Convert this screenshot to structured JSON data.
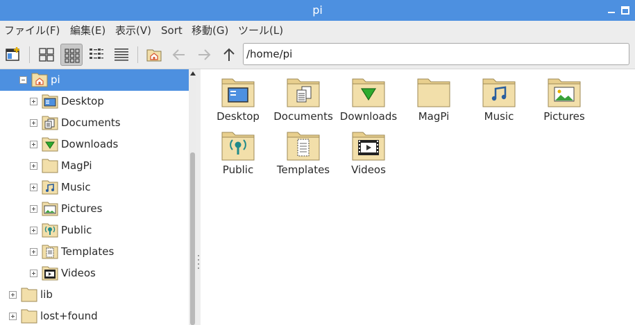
{
  "window": {
    "title": "pi"
  },
  "menu": [
    "ファイル(F)",
    "編集(E)",
    "表示(V)",
    "Sort",
    "移動(G)",
    "ツール(L)"
  ],
  "toolbar": {
    "path_value": "/home/pi",
    "active_view": "icon-view"
  },
  "sidebar": {
    "items": [
      {
        "label": "pi",
        "icon": "home-folder-icon",
        "level": 1,
        "expanded": true,
        "selected": true
      },
      {
        "label": "Desktop",
        "icon": "desktop-folder-icon",
        "level": 2,
        "expanded": false
      },
      {
        "label": "Documents",
        "icon": "documents-folder-icon",
        "level": 2,
        "expanded": false
      },
      {
        "label": "Downloads",
        "icon": "downloads-folder-icon",
        "level": 2,
        "expanded": false
      },
      {
        "label": "MagPi",
        "icon": "folder-icon",
        "level": 2,
        "expanded": false
      },
      {
        "label": "Music",
        "icon": "music-folder-icon",
        "level": 2,
        "expanded": false
      },
      {
        "label": "Pictures",
        "icon": "pictures-folder-icon",
        "level": 2,
        "expanded": false
      },
      {
        "label": "Public",
        "icon": "public-folder-icon",
        "level": 2,
        "expanded": false
      },
      {
        "label": "Templates",
        "icon": "templates-folder-icon",
        "level": 2,
        "expanded": false
      },
      {
        "label": "Videos",
        "icon": "videos-folder-icon",
        "level": 2,
        "expanded": false
      },
      {
        "label": "lib",
        "icon": "folder-icon",
        "level": 0,
        "expanded": false
      },
      {
        "label": "lost+found",
        "icon": "folder-icon",
        "level": 0,
        "expanded": false
      }
    ]
  },
  "main": {
    "items": [
      {
        "label": "Desktop",
        "icon": "desktop-folder-icon"
      },
      {
        "label": "Documents",
        "icon": "documents-folder-icon"
      },
      {
        "label": "Downloads",
        "icon": "downloads-folder-icon"
      },
      {
        "label": "MagPi",
        "icon": "folder-icon"
      },
      {
        "label": "Music",
        "icon": "music-folder-icon"
      },
      {
        "label": "Pictures",
        "icon": "pictures-folder-icon"
      },
      {
        "label": "Public",
        "icon": "public-folder-icon"
      },
      {
        "label": "Templates",
        "icon": "templates-folder-icon"
      },
      {
        "label": "Videos",
        "icon": "videos-folder-icon"
      }
    ]
  },
  "colors": {
    "titlebar": "#4d90e0",
    "selection": "#4d90e0",
    "folder_body": "#f2dfaa",
    "folder_tab": "#e8cf8e"
  }
}
